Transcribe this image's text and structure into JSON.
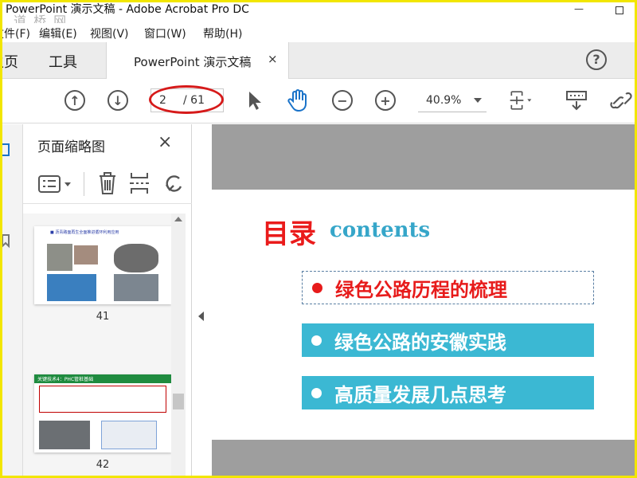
{
  "window": {
    "title": "PowerPoint 演示文稿 - Adobe Acrobat Pro DC",
    "watermark": "道 桥 网"
  },
  "menu": {
    "items": [
      "文件(F)",
      "编辑(E)",
      "视图(V)",
      "窗口(W)",
      "帮助(H)"
    ]
  },
  "tabs": {
    "home": "主页",
    "tools": "工具",
    "document": "PowerPoint 演示文稿",
    "close": "×",
    "help": "?"
  },
  "toolbar": {
    "page_current": "2",
    "page_total": "/ 61",
    "zoom": "40.9%"
  },
  "sidebar": {
    "title": "页面缩略图",
    "close": "×",
    "thumbnails": [
      {
        "page": "41",
        "caption": "■ 沥青路面再生全面推进循环利用应用"
      },
      {
        "page": "42",
        "heading": "关键技术4：PHC管桩基础"
      }
    ]
  },
  "slide": {
    "title_cn": "目录",
    "title_en": "contents",
    "toc": [
      {
        "text": "绿色公路历程的梳理",
        "active": true
      },
      {
        "text": "绿色公路的安徽实践",
        "active": false
      },
      {
        "text": "高质量发展几点思考",
        "active": false
      }
    ]
  },
  "colors": {
    "accent_red": "#e71b1b",
    "accent_cyan": "#3bb8d3",
    "annotation_red": "#d61a1a",
    "frame_yellow": "#f2e600"
  }
}
